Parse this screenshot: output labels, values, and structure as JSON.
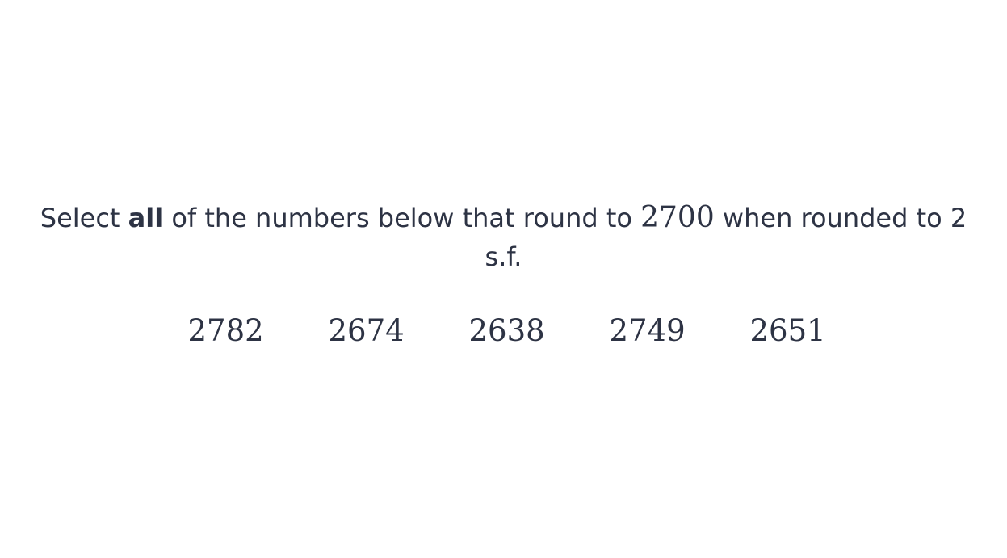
{
  "question": {
    "part1": "Select ",
    "emphasis": "all",
    "part2": " of the numbers below that round to ",
    "target": "2700",
    "part3": " when rounded to 2 s.f."
  },
  "options": [
    {
      "label": "2782"
    },
    {
      "label": "2674"
    },
    {
      "label": "2638"
    },
    {
      "label": "2749"
    },
    {
      "label": "2651"
    }
  ]
}
